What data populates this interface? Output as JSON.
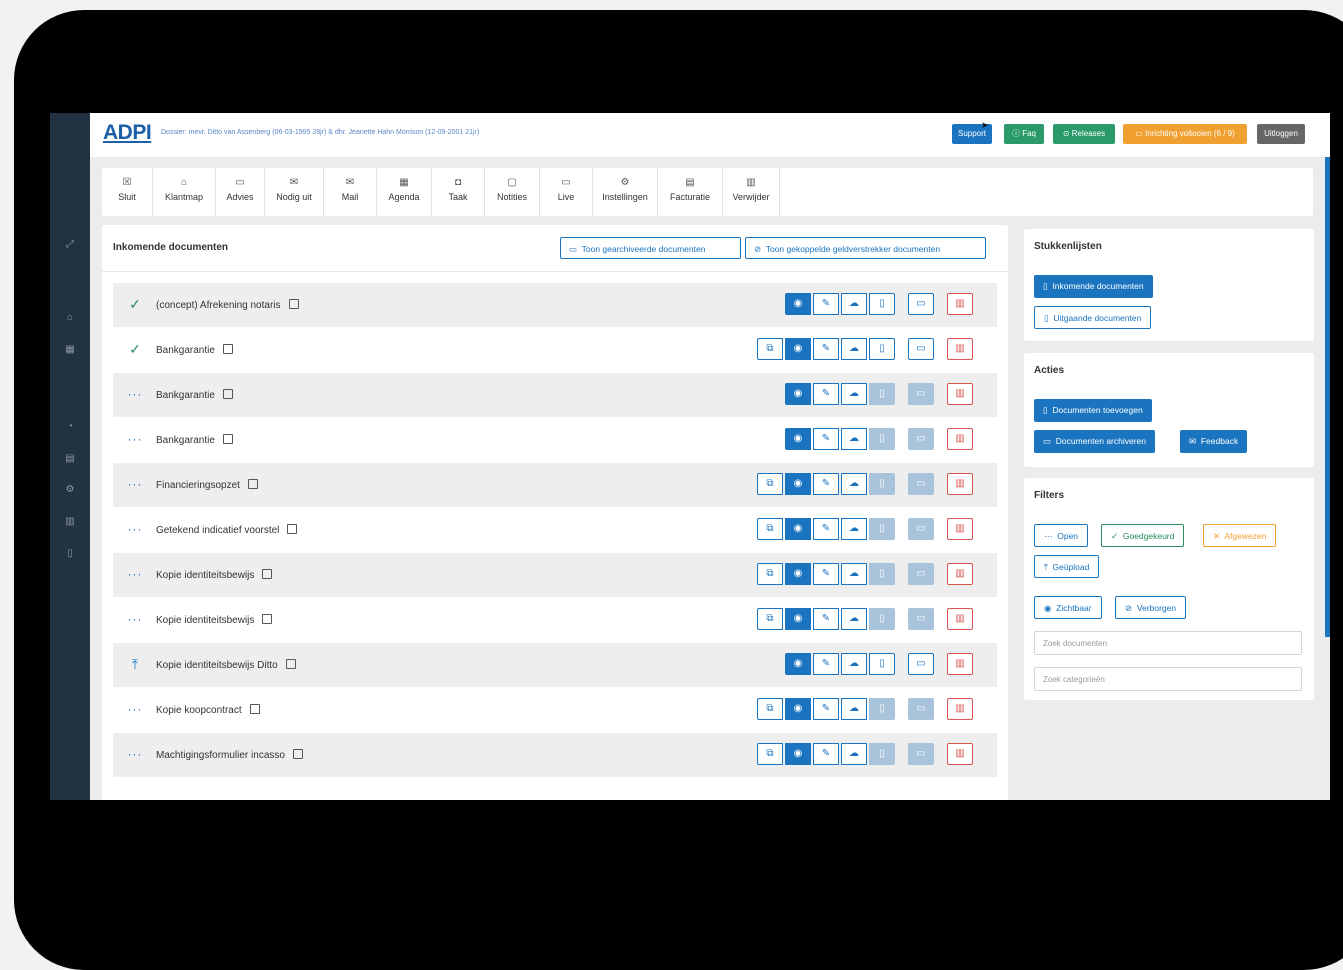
{
  "topbar": {
    "logo": "ADPI",
    "dossier": "Dossier: mevr. Ditto van Assenberg (06-03-1995 28jr) & dhr. Jeanette Hahn Morrison (12-09-2001 21jr)",
    "support": "Support",
    "faq": "Faq",
    "releases": "Releases",
    "inrichting": "Inrichting voltooien (6 / 9)",
    "uitloggen": "Uitloggen"
  },
  "toolbar": [
    {
      "label": "Sluit",
      "icon": "close-icon"
    },
    {
      "label": "Klantmap",
      "icon": "home-icon"
    },
    {
      "label": "Advies",
      "icon": "folder-icon"
    },
    {
      "label": "Nodig uit",
      "icon": "invite-icon"
    },
    {
      "label": "Mail",
      "icon": "mail-icon"
    },
    {
      "label": "Agenda",
      "icon": "calendar-icon"
    },
    {
      "label": "Taak",
      "icon": "task-icon"
    },
    {
      "label": "Notities",
      "icon": "note-icon"
    },
    {
      "label": "Live",
      "icon": "video-icon"
    },
    {
      "label": "Instellingen",
      "icon": "gear-icon"
    },
    {
      "label": "Facturatie",
      "icon": "invoice-icon"
    },
    {
      "label": "Verwijder",
      "icon": "trash-icon"
    }
  ],
  "main": {
    "title": "Inkomende documenten",
    "btn_archived": "Toon gearchiveerde documenten",
    "btn_linked": "Toon gekoppelde geldverstrekker documenten",
    "rows": [
      {
        "name": "(concept) Afrekening notaris",
        "status": "approved"
      },
      {
        "name": "Bankgarantie",
        "status": "approved"
      },
      {
        "name": "Bankgarantie",
        "status": "open"
      },
      {
        "name": "Bankgarantie",
        "status": "open"
      },
      {
        "name": "Financieringsopzet",
        "status": "open"
      },
      {
        "name": "Getekend indicatief voorstel",
        "status": "open"
      },
      {
        "name": "Kopie identiteitsbewijs",
        "status": "open"
      },
      {
        "name": "Kopie identiteitsbewijs",
        "status": "open"
      },
      {
        "name": "Kopie identiteitsbewijs Ditto",
        "status": "uploaded"
      },
      {
        "name": "Kopie koopcontract",
        "status": "open"
      },
      {
        "name": "Machtigingsformulier incasso",
        "status": "open"
      }
    ]
  },
  "stukkenlijsten": {
    "title": "Stukkenlijsten",
    "incoming": "Inkomende documenten",
    "outgoing": "Uitgaande documenten"
  },
  "acties": {
    "title": "Acties",
    "add": "Documenten toevoegen",
    "archive": "Documenten archiveren",
    "feedback": "Feedback"
  },
  "filters": {
    "title": "Filters",
    "open": "Open",
    "approved": "Goedgekeurd",
    "rejected": "Afgewezen",
    "uploaded": "Geüpload",
    "visible": "Zichtbaar",
    "hidden": "Verborgen",
    "search_docs": "Zoek documenten",
    "search_cats": "Zoek categorieën"
  },
  "colors": {
    "primary": "#1a74c0",
    "success": "#2a8a5a",
    "warning": "#f0a030",
    "danger": "#d9534f",
    "sidebar": "#233241"
  }
}
